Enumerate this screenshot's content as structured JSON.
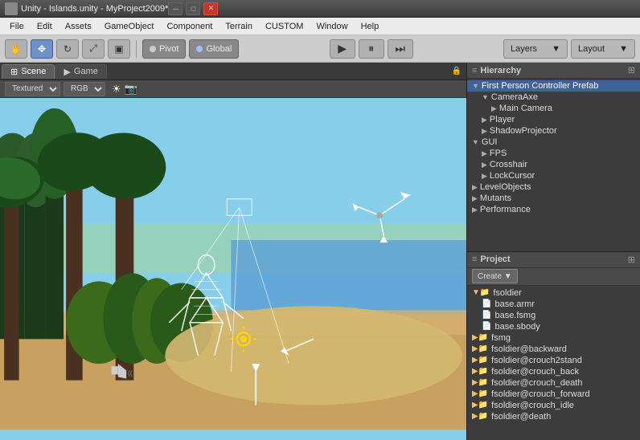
{
  "titlebar": {
    "title": "Unity - Islands.unity - MyProject2009*",
    "icon": "unity-icon",
    "minimize_label": "─",
    "maximize_label": "□",
    "close_label": "✕"
  },
  "menubar": {
    "items": [
      "File",
      "Edit",
      "Assets",
      "GameObject",
      "Component",
      "Terrain",
      "CUSTOM",
      "Window",
      "Help"
    ]
  },
  "toolbar": {
    "hand_tool": "✋",
    "move_tool": "✥",
    "rotate_tool": "↻",
    "scale_tool": "⤢",
    "rect_tool": "▣",
    "pivot_label": "Pivot",
    "global_label": "Global",
    "play_label": "▶",
    "pause_label": "⏸",
    "step_label": "⏭",
    "layers_label": "Layers",
    "layout_label": "Layout"
  },
  "scene_tab": {
    "label": "Scene",
    "game_label": "Game",
    "view_mode": "Textured",
    "color_mode": "RGB"
  },
  "hierarchy": {
    "title": "Hierarchy",
    "items": [
      {
        "label": "First Person Controller Prefab",
        "indent": 0,
        "expanded": true,
        "selected": true
      },
      {
        "label": "CameraAxe",
        "indent": 1,
        "expanded": true
      },
      {
        "label": "Main Camera",
        "indent": 2,
        "expanded": false
      },
      {
        "label": "Player",
        "indent": 1,
        "expanded": false
      },
      {
        "label": "ShadowProjector",
        "indent": 1,
        "expanded": false
      },
      {
        "label": "GUI",
        "indent": 0,
        "expanded": true
      },
      {
        "label": "FPS",
        "indent": 1,
        "expanded": false
      },
      {
        "label": "Crosshair",
        "indent": 1,
        "expanded": false
      },
      {
        "label": "LockCursor",
        "indent": 1,
        "expanded": false
      },
      {
        "label": "LevelObjects",
        "indent": 0,
        "expanded": false
      },
      {
        "label": "Mutants",
        "indent": 0,
        "expanded": false
      },
      {
        "label": "Performance",
        "indent": 0,
        "expanded": false
      }
    ]
  },
  "project": {
    "title": "Project",
    "create_label": "Create ▼",
    "items": [
      {
        "label": "fsoldier",
        "indent": 0,
        "type": "folder",
        "expanded": true
      },
      {
        "label": "base.armr",
        "indent": 1,
        "type": "file3d"
      },
      {
        "label": "base.fsmg",
        "indent": 1,
        "type": "file3d"
      },
      {
        "label": "base.sbody",
        "indent": 1,
        "type": "file3d"
      },
      {
        "label": "fsmg",
        "indent": 0,
        "type": "folder",
        "expanded": false
      },
      {
        "label": "fsoldier@backward",
        "indent": 0,
        "type": "folder",
        "expanded": false
      },
      {
        "label": "fsoldier@crouch2stand",
        "indent": 0,
        "type": "folder",
        "expanded": false
      },
      {
        "label": "fsoldier@crouch_back",
        "indent": 0,
        "type": "folder",
        "expanded": false
      },
      {
        "label": "fsoldier@crouch_death",
        "indent": 0,
        "type": "folder",
        "expanded": false
      },
      {
        "label": "fsoldier@crouch_forward",
        "indent": 0,
        "type": "folder",
        "expanded": false
      },
      {
        "label": "fsoldier@crouch_idle",
        "indent": 0,
        "type": "folder",
        "expanded": false
      },
      {
        "label": "fsoldier@death",
        "indent": 0,
        "type": "folder",
        "expanded": false
      }
    ]
  }
}
